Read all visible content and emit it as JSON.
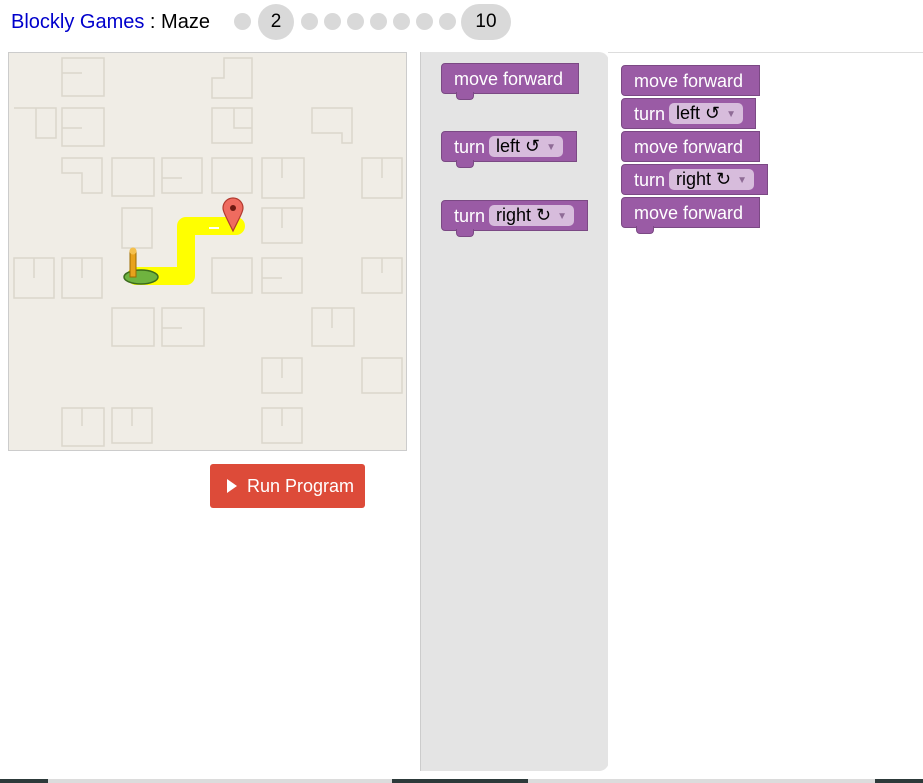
{
  "header": {
    "app_link": "Blockly Games",
    "separator": " : ",
    "game_name": "Maze",
    "current_level": "2",
    "last_level": "10"
  },
  "run_button": {
    "label": "Run Program",
    "icon": "play-icon"
  },
  "toolbox": {
    "blocks": [
      {
        "type": "move",
        "label": "move forward"
      },
      {
        "type": "turn",
        "label": "turn",
        "value": "left ↺"
      },
      {
        "type": "turn",
        "label": "turn",
        "value": "right ↻"
      }
    ]
  },
  "workspace": {
    "blocks": [
      {
        "type": "move",
        "label": "move forward"
      },
      {
        "type": "turn",
        "label": "turn",
        "value": "left ↺"
      },
      {
        "type": "move",
        "label": "move forward"
      },
      {
        "type": "turn",
        "label": "turn",
        "value": "right ↻"
      },
      {
        "type": "move",
        "label": "move forward"
      }
    ]
  },
  "colors": {
    "block_purple": "#9a5ba5",
    "dropdown": "#d7bcdc",
    "run_button": "#dd4b39",
    "path_yellow": "#ffff00",
    "link_blue": "#0000cc"
  }
}
